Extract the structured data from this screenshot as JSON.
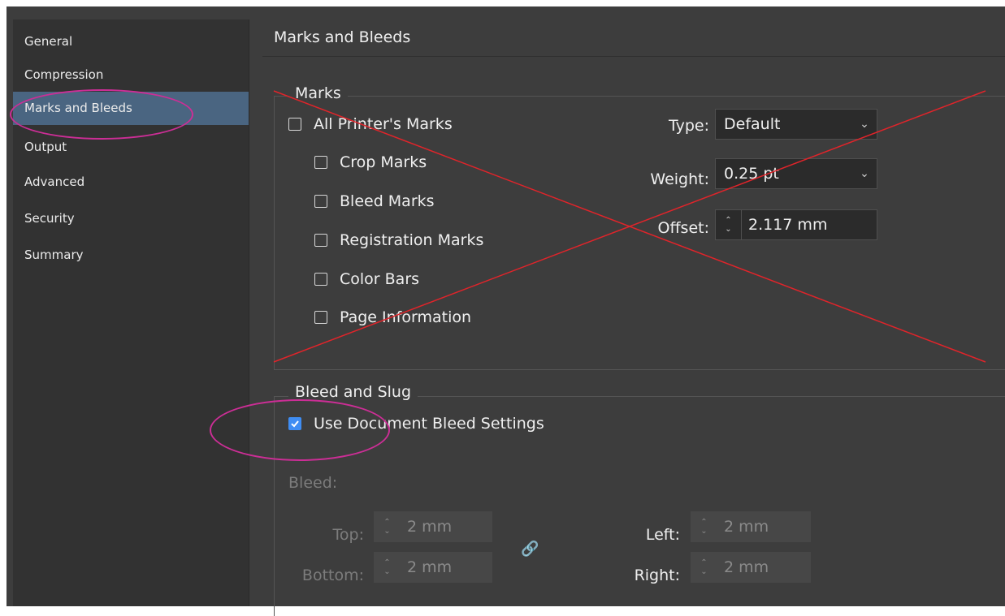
{
  "sidebar": {
    "items": [
      {
        "label": "General"
      },
      {
        "label": "Compression"
      },
      {
        "label": "Marks and Bleeds",
        "active": true
      },
      {
        "label": "Output"
      },
      {
        "label": "Advanced"
      },
      {
        "label": "Security"
      },
      {
        "label": "Summary"
      }
    ]
  },
  "page": {
    "title": "Marks and Bleeds"
  },
  "marks": {
    "title": "Marks",
    "all_printers_marks": {
      "label": "All Printer's Marks",
      "checked": false
    },
    "options": [
      {
        "label": "Crop Marks",
        "checked": false
      },
      {
        "label": "Bleed Marks",
        "checked": false
      },
      {
        "label": "Registration Marks",
        "checked": false
      },
      {
        "label": "Color Bars",
        "checked": false
      },
      {
        "label": "Page Information",
        "checked": false
      }
    ],
    "type": {
      "label": "Type:",
      "value": "Default"
    },
    "weight": {
      "label": "Weight:",
      "value": "0.25 pt"
    },
    "offset": {
      "label": "Offset:",
      "value": "2.117 mm"
    }
  },
  "bleed_slug": {
    "title": "Bleed and Slug",
    "use_document": {
      "label": "Use Document Bleed Settings",
      "checked": true
    },
    "bleed_label": "Bleed:",
    "top": {
      "label": "Top:",
      "value": "2 mm"
    },
    "bottom": {
      "label": "Bottom:",
      "value": "2 mm"
    },
    "left": {
      "label": "Left:",
      "value": "2 mm"
    },
    "right": {
      "label": "Right:",
      "value": "2 mm"
    }
  },
  "colors": {
    "accent": "#3f8df3",
    "annotation": "#cc2e96",
    "cross": "#e0242a",
    "sidebar_active": "#4a6581"
  },
  "icons": [
    "chevron-down-icon",
    "spin-arrows-icon",
    "link-icon",
    "checkmark-icon"
  ]
}
